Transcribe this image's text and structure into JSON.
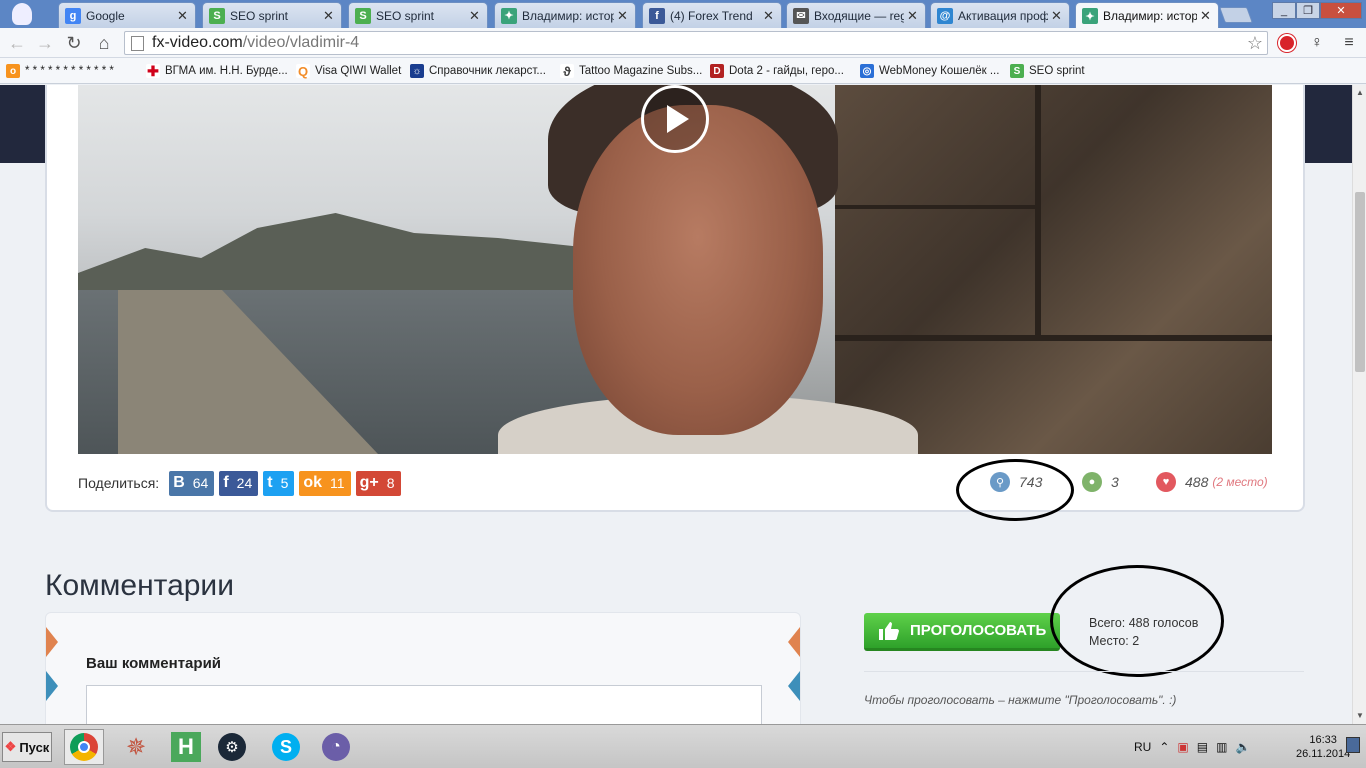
{
  "browser": {
    "tabs": [
      {
        "label": "Google",
        "icon": "google-icon",
        "color": "#4285f4",
        "active": false
      },
      {
        "label": "SEO sprint",
        "icon": "seosprint-icon",
        "color": "#4caf50",
        "active": false
      },
      {
        "label": "SEO sprint",
        "icon": "seosprint-icon",
        "color": "#4caf50",
        "active": false
      },
      {
        "label": "Владимир: истори",
        "icon": "fxvideo-icon",
        "color": "#3aa37a",
        "active": false
      },
      {
        "label": "(4) Forex Trend",
        "icon": "facebook-icon",
        "color": "#3b5998",
        "active": false
      },
      {
        "label": "Входящие — rego",
        "icon": "mail-icon",
        "color": "#555555",
        "active": false
      },
      {
        "label": "Активация профи",
        "icon": "at-icon",
        "color": "#2f86d1",
        "active": false
      },
      {
        "label": "Владимир: истори",
        "icon": "fxvideo-icon",
        "color": "#3aa37a",
        "active": true
      }
    ],
    "url_host": "fx-video.com",
    "url_path": "/video/vladimir-4",
    "bookmarks": [
      {
        "label": "* * * * * * * * * * * *",
        "icon": "odnoklassniki-icon",
        "color": "#f7931e"
      },
      {
        "label": "ВГМА им. Н.Н. Бурде...",
        "icon": "red-cross-icon",
        "color": "#d0021b"
      },
      {
        "label": "Visa QIWI Wallet",
        "icon": "qiwi-icon",
        "color": "#f28c28"
      },
      {
        "label": "Справочник лекарст...",
        "icon": "rls-icon",
        "color": "#1a3d8f"
      },
      {
        "label": "Tattoo Magazine Subs...",
        "icon": "tattoo-icon",
        "color": "#444444"
      },
      {
        "label": "Dota 2 - гайды, геро...",
        "icon": "dota-icon",
        "color": "#b22222"
      },
      {
        "label": "WebMoney Кошелёк ...",
        "icon": "webmoney-icon",
        "color": "#2a6fd6"
      },
      {
        "label": "SEO sprint",
        "icon": "seosprint-icon",
        "color": "#4caf50"
      }
    ]
  },
  "share": {
    "label": "Поделиться:",
    "buttons": [
      {
        "name": "vk",
        "icon": "В",
        "count": "64",
        "color": "#4a76a8"
      },
      {
        "name": "facebook",
        "icon": "f",
        "count": "24",
        "color": "#3b5998"
      },
      {
        "name": "twitter",
        "icon": "t",
        "count": "5",
        "color": "#1da1f2"
      },
      {
        "name": "odnoklassniki",
        "icon": "ok",
        "count": "11",
        "color": "#f7931e"
      },
      {
        "name": "googleplus",
        "icon": "g+",
        "count": "8",
        "color": "#d34836"
      }
    ]
  },
  "stats": {
    "views": "743",
    "comments": "3",
    "likes": "488",
    "rank": "(2 место)"
  },
  "comments": {
    "title": "Комментарии",
    "form_label": "Ваш комментарий"
  },
  "vote": {
    "button_label": "ПРОГОЛОСОВАТЬ",
    "total": "Всего: 488 голосов",
    "place": "Место: 2",
    "hint": "Чтобы проголосовать – нажмите \"Проголосовать\". :)"
  },
  "taskbar": {
    "start_label": "Пуск",
    "language": "RU",
    "time": "16:33",
    "date": "26.11.2014",
    "apps": [
      "chrome-icon",
      "krita-icon",
      "h-app-icon",
      "steam-icon",
      "skype-icon",
      "torrent-icon"
    ]
  },
  "colors": {
    "accent_green": "#3cb936",
    "header_dark": "#22283d",
    "rank_pink": "#e0787f"
  }
}
